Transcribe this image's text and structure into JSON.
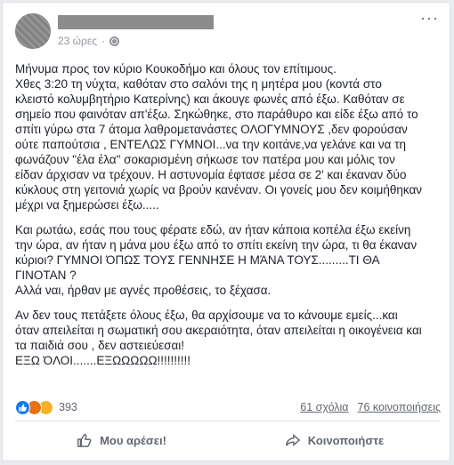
{
  "post": {
    "time": "23 ώρες",
    "paragraphs": [
      "Μήνυμα προς τον κύριο Κουκοδήμο και όλους τον επίτιμους.\nΧθες 3:20 τη νύχτα, καθόταν στο σαλόνι της η μητέρα μου (κοντά στο\nκλειστό κολυμβητήριο Κατερίνης) και άκουγε φωνές από έξω. Καθόταν σε\nσημείο που φαινόταν απ'έξω. Σηκώθηκε, στο παράθυρο και είδε έξω από το\nσπίτι γύρω στα 7 άτομα λαθρομετανάστες ΟΛΟΓΥΜΝΟΥΣ ,δεν φορούσαν\nούτε παπούτσια , ΕΝΤΕΛΩΣ ΓΥΜΝΟΙ...να την κοιτάνε,να γελάνε και να τη\nφωνάζουν \"έλα έλα\" σοκαρισμένη σήκωσε τον πατέρα μου και μόλις τον\nείδαν άρχισαν να τρέχουν. Η αστυνομία έφτασε μέσα σε 2' και έκαναν δύο\nκύκλους στη γειτονιά χωρίς να βρούν κανέναν. Οι γονείς μου δεν κοιμήθηκαν\nμέχρι να ξημερώσει έξω.....",
      "Και ρωτάω, εσάς που τους φέρατε εδώ, αν ήταν κάποια κοπέλα έξω εκείνη\nτην ώρα, αν ήταν η μάνα μου έξω από το σπίτι εκείνη την ώρα, τι θα έκαναν\nκύριοι? ΓΥΜΝΟΙ ΌΠΩΣ ΤΟΥΣ ΓΕΝΝΗΣΕ Η ΜΆΝΑ ΤΟΥΣ.........ΤΙ ΘΑ\nΓΙΝΟΤΑΝ ?\nΑλλά ναι, ήρθαν με αγνές προθέσεις, το ξέχασα.",
      "Αν δεν τους πετάξετε όλους έξω, θα αρχίσουμε να το κάνουμε εμείς...και\nόταν απειλείται η σωματική σου ακεραιότητα, όταν απειλείται η οικογένεια και\nτα παιδιά σου , δεν αστειεύεσαι!\nΕΞΩ ΌΛΟΙ.......ΕΞΩΩΩΩΩ!!!!!!!!!!"
    ]
  },
  "stats": {
    "reactions_count": "393",
    "comments": "61 σχόλια",
    "shares": "76 κοινοποιήσεις"
  },
  "actions": {
    "like_label": "Μου αρέσει!",
    "share_label": "Κοινοποιήστε"
  }
}
